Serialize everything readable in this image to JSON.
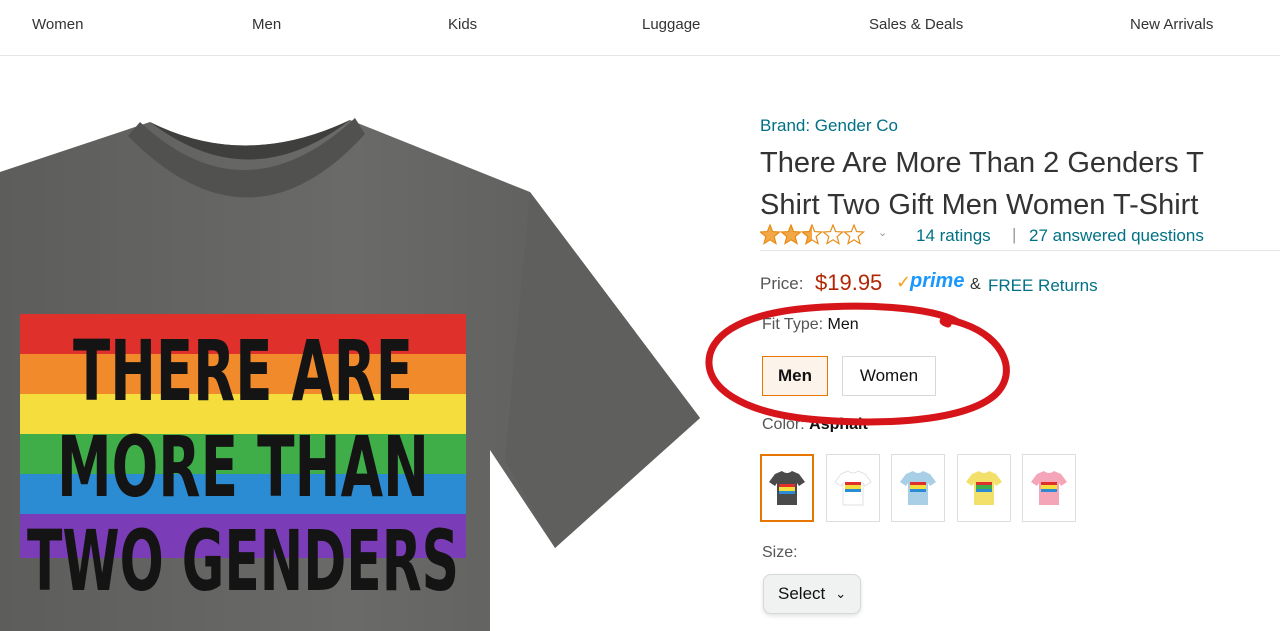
{
  "nav": {
    "items": [
      "Women",
      "Men",
      "Kids",
      "Luggage",
      "Sales & Deals",
      "New Arrivals"
    ]
  },
  "product": {
    "image_text": [
      "THERE ARE",
      "MORE THAN",
      "TWO GENDERS"
    ],
    "brand": "Brand: Gender Co",
    "title_line1": "There Are More Than 2 Genders T",
    "title_line2": "Shirt Two Gift Men Women T-Shirt",
    "rating_stars": 2.5,
    "ratings_count": "14 ratings",
    "separator": "|",
    "answered": "27 answered questions",
    "price_label": "Price:",
    "price": "$19.95",
    "prime": "prime",
    "prime_check": "✓",
    "amp": "&",
    "free_returns": "FREE Returns",
    "fit_label": "Fit Type:",
    "fit_value": "Men",
    "fit_options": [
      "Men",
      "Women"
    ],
    "color_label": "Color:",
    "color_value": "Asphalt",
    "swatch_colors": [
      "#4a4a4a",
      "#ffffff",
      "#a9cfe6",
      "#f2e06a",
      "#f4a6b8"
    ],
    "size_label": "Size:",
    "size_select": "Select"
  },
  "colors": {
    "link": "#007185",
    "price": "#b12704",
    "prime": "#1a98ff",
    "accent": "#e77600",
    "star": "#f3a847",
    "annotation": "#d6151b"
  }
}
